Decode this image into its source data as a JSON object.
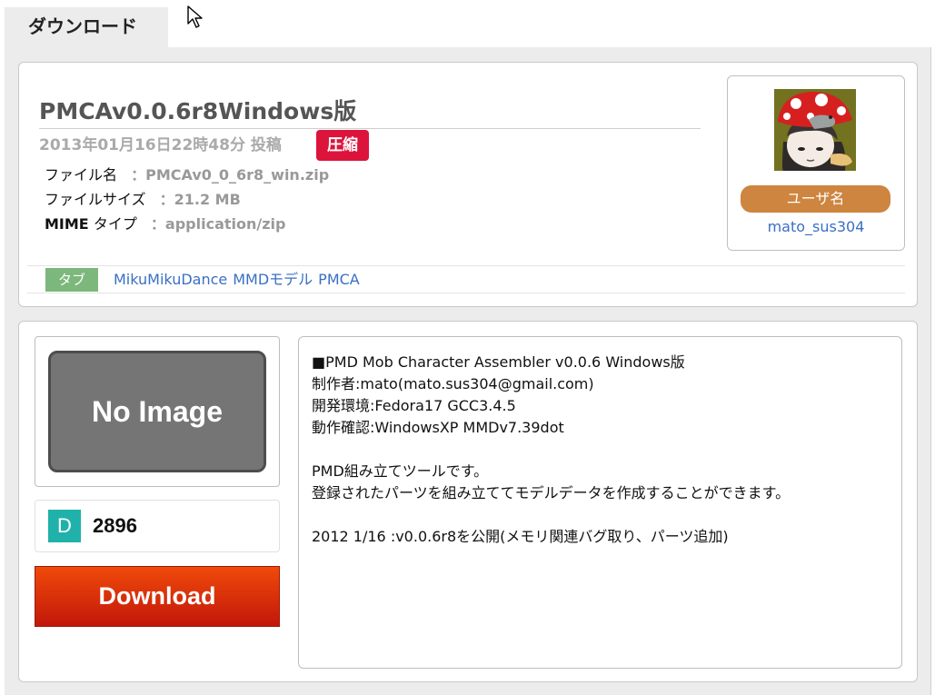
{
  "tab": {
    "label": "ダウンロード"
  },
  "file": {
    "title": "PMCAv0.0.6r8Windows版",
    "date": "2013年01月16日22時48分 投稿",
    "badge": "圧縮",
    "name_label": "ファイル名",
    "name_value": "：PMCAv0_0_6r8_win.zip",
    "size_label": "ファイルサイズ",
    "size_value": "：21.2 MB",
    "mime_label_strong": "MIME",
    "mime_label_rest": " タイプ",
    "mime_value": "：application/zip"
  },
  "tags": {
    "label": "タブ",
    "items": [
      "MikuMikuDance",
      "MMDモデル",
      "PMCA"
    ]
  },
  "user": {
    "label": "ユーザ名",
    "name": "mato_sus304"
  },
  "preview": {
    "no_image_text": "No Image"
  },
  "downloads": {
    "icon_letter": "D",
    "count": "2896"
  },
  "download_button": {
    "label": "Download"
  },
  "description": "■PMD Mob Character Assembler v0.0.6 Windows版\n制作者:mato(mato.sus304@gmail.com)\n開発環境:Fedora17 GCC3.4.5\n動作確認:WindowsXP MMDv7.39dot\n\nPMD組み立てツールです。\n登録されたパーツを組み立ててモデルデータを作成することができます。\n\n2012 1/16 :v0.0.6r8を公開(メモリ関連バグ取り、パーツ追加)",
  "colors": {
    "badge": "#dc143c",
    "tag_label": "#7cb77c",
    "user_label": "#cd853f",
    "link": "#3a6fc4",
    "download_count_icon": "#20b2aa",
    "download_button": "#e0300a"
  },
  "icons": {
    "cursor": "mouse-pointer-icon",
    "avatar": "mushroom-girl-avatar"
  }
}
